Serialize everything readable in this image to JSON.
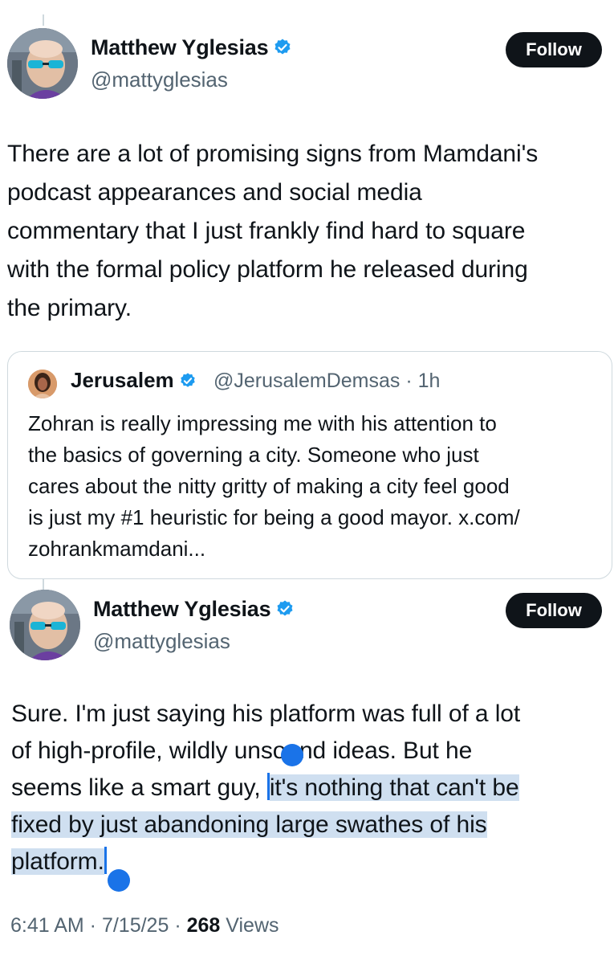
{
  "tweet1": {
    "author_name": "Matthew Yglesias",
    "author_handle": "@mattyglesias",
    "follow_label": "Follow",
    "text_lines": [
      "There are a lot of promising signs from Mamdani's",
      "podcast appearances and social media",
      "commentary that I just frankly find hard to square",
      "with the formal policy platform he released during",
      "the primary."
    ]
  },
  "quote": {
    "author_name": "Jerusalem",
    "author_handle": "@JerusalemDemsas",
    "separator": "·",
    "time": "1h",
    "text_lines": [
      "Zohran is really impressing me with his attention to",
      "the basics of governing a city. Someone who just",
      "cares about the nitty gritty of making a city feel good",
      "is just my #1 heuristic for being a good mayor. x.com/",
      "zohrankmamdani..."
    ]
  },
  "tweet2": {
    "author_name": "Matthew Yglesias",
    "author_handle": "@mattyglesias",
    "follow_label": "Follow",
    "line1": "Sure. I'm just saying his platform was full of a lot",
    "line2": "of high-profile, wildly unsound ideas. But he",
    "line3_pre": "seems like a smart guy, ",
    "line3_sel": "it's nothing that can't be",
    "line4_sel": "fixed by just abandoning large swathes of his",
    "line5_sel": "platform."
  },
  "meta": {
    "time": "6:41 AM",
    "sep1": " · ",
    "date": "7/15/25",
    "sep2": " · ",
    "views_count": "268",
    "views_label": " Views"
  },
  "colors": {
    "verified": "#1d9bf0",
    "selection": "#cfdff0",
    "selection_handle": "#1a73e8",
    "follow_bg": "#0f1419"
  }
}
